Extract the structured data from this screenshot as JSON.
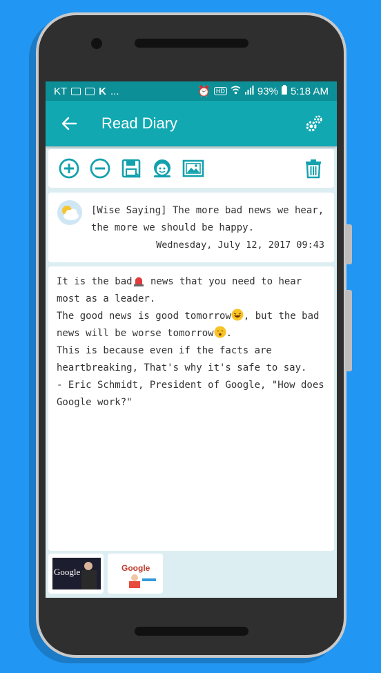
{
  "statusbar": {
    "carrier": "KT",
    "more": "...",
    "battery": "93%",
    "time": "5:18 AM",
    "hd_badge": "HD"
  },
  "appbar": {
    "title": "Read Diary"
  },
  "toolbar": {
    "icons": [
      "plus-circle-icon",
      "minus-circle-icon",
      "save-icon",
      "emoji-sticker-icon",
      "image-icon",
      "trash-icon"
    ]
  },
  "entry": {
    "weather_icon": "partly-cloudy-icon",
    "saying": "[Wise Saying] The more bad news we hear, the more we should be happy.",
    "date": "Wednesday, July 12, 2017 09:43",
    "body": {
      "line1a": "It is the bad",
      "line1b": " news that you need to hear most as a leader.",
      "line2a": "The good news is good tomorrow",
      "line2b": ", but the bad news will be worse tomorrow",
      "line2c": ".",
      "line3": "This is because even if the facts are heartbreaking, That's why it's safe to say.",
      "line4": "- Eric Schmidt, President of Google, \"How does Google work?\""
    }
  },
  "thumbnails": {
    "thumb1_text": "Google",
    "thumb2_text": "Google"
  },
  "colors": {
    "statusbar": "#0d8f97",
    "appbar": "#11a8b2",
    "accent": "#13a1ad",
    "background": "#2196f3"
  }
}
